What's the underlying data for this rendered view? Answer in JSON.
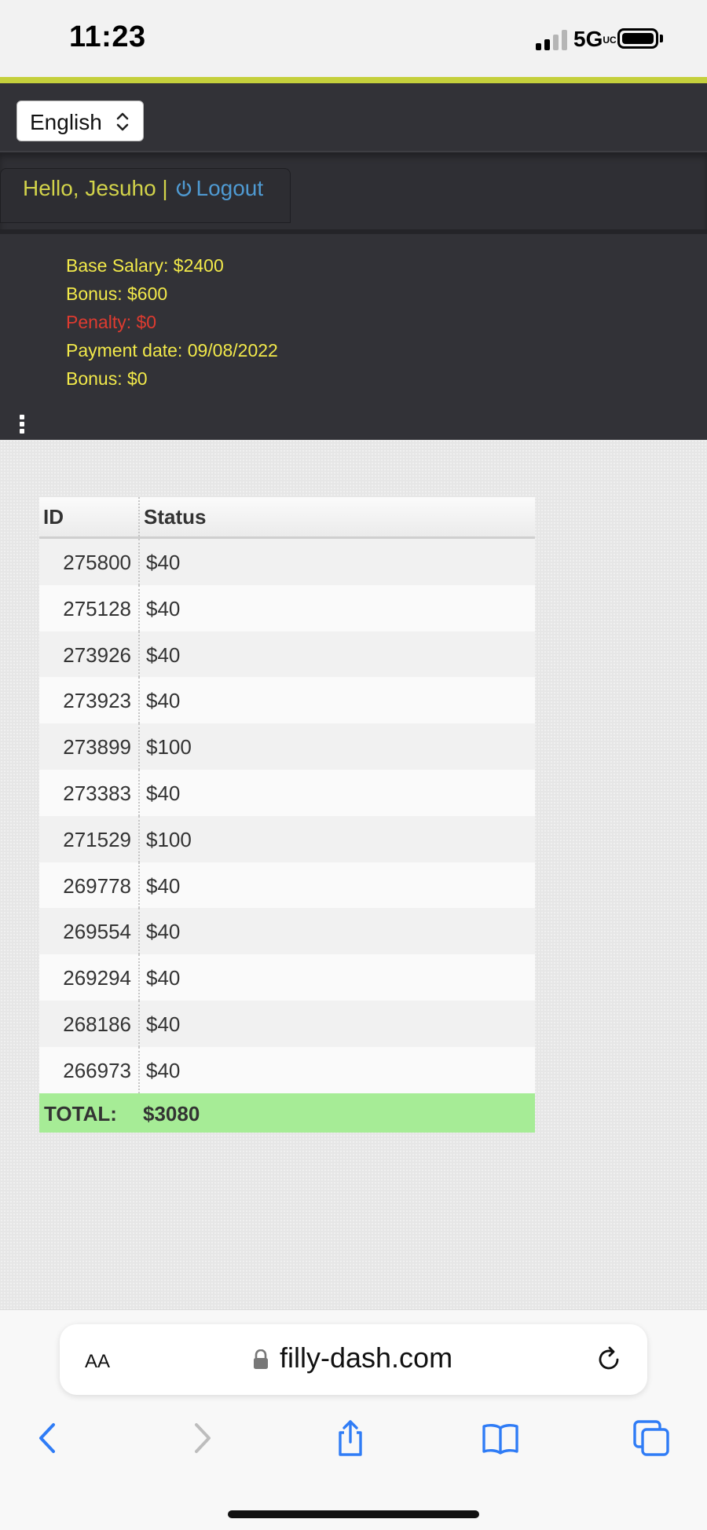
{
  "status_bar": {
    "time": "11:23",
    "network": "5G",
    "network_suffix": "UC"
  },
  "header": {
    "language": "English",
    "greeting": "Hello, Jesuho |",
    "logout_label": "Logout",
    "info": {
      "base_salary": "Base Salary: $2400",
      "bonus": "Bonus: $600",
      "penalty": "Penalty: $0",
      "payment_date": "Payment date: 09/08/2022",
      "bonus2": "Bonus: $0"
    }
  },
  "table": {
    "columns": [
      "ID",
      "Status"
    ],
    "rows": [
      {
        "id": "275800",
        "status": "$40"
      },
      {
        "id": "275128",
        "status": "$40"
      },
      {
        "id": "273926",
        "status": "$40"
      },
      {
        "id": "273923",
        "status": "$40"
      },
      {
        "id": "273899",
        "status": "$100"
      },
      {
        "id": "273383",
        "status": "$40"
      },
      {
        "id": "271529",
        "status": "$100"
      },
      {
        "id": "269778",
        "status": "$40"
      },
      {
        "id": "269554",
        "status": "$40"
      },
      {
        "id": "269294",
        "status": "$40"
      },
      {
        "id": "268186",
        "status": "$40"
      },
      {
        "id": "266973",
        "status": "$40"
      }
    ],
    "total_label": "TOTAL:",
    "total_value": "$3080"
  },
  "browser": {
    "text_size_label": "AA",
    "url": "filly-dash.com",
    "toolbar_icons": [
      "back-icon",
      "forward-icon",
      "share-icon",
      "bookmarks-icon",
      "tabs-icon"
    ]
  },
  "colors": {
    "accent": "#c5d03c",
    "header_bg": "#323237",
    "info_text": "#f2e94a",
    "penalty_text": "#de3b30",
    "link": "#4f9ad2",
    "total_bg": "#a6ec96"
  }
}
